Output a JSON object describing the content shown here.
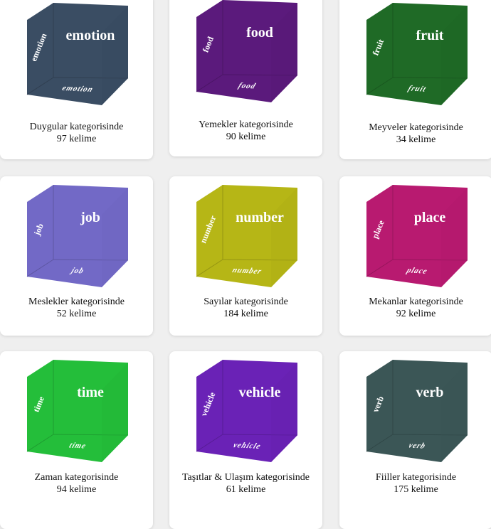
{
  "categories": [
    {
      "word": "emotion",
      "color": "#3a4d63",
      "caption_name": "Duygular kategorisinde",
      "count_text": "97 kelime"
    },
    {
      "word": "food",
      "color": "#5b1a7c",
      "caption_name": "Yemekler kategorisinde",
      "count_text": "90 kelime"
    },
    {
      "word": "fruit",
      "color": "#1f6a26",
      "caption_name": "Meyveler kategorisinde",
      "count_text": "34 kelime"
    },
    {
      "word": "job",
      "color": "#7269c6",
      "caption_name": "Meslekler kategorisinde",
      "count_text": "52 kelime"
    },
    {
      "word": "number",
      "color": "#b6b616",
      "caption_name": "Sayılar kategorisinde",
      "count_text": "184 kelime"
    },
    {
      "word": "place",
      "color": "#b81a70",
      "caption_name": "Mekanlar kategorisinde",
      "count_text": "92 kelime"
    },
    {
      "word": "time",
      "color": "#24be3a",
      "caption_name": "Zaman kategorisinde",
      "count_text": "94 kelime"
    },
    {
      "word": "vehicle",
      "color": "#6a22b6",
      "caption_name": "Taşıtlar & Ulaşım kategorisinde",
      "count_text": "61 kelime"
    },
    {
      "word": "verb",
      "color": "#3b5656",
      "caption_name": "Fiiller kategorisinde",
      "count_text": "175 kelime"
    }
  ]
}
